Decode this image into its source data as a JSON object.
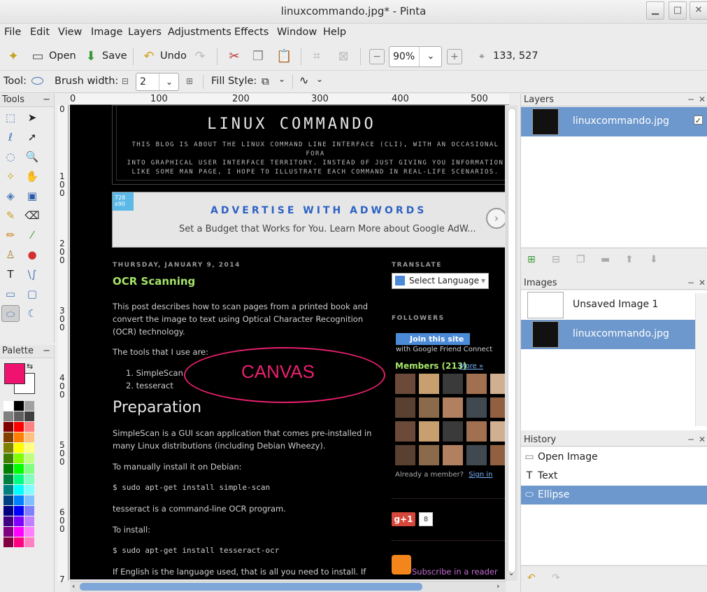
{
  "window": {
    "title": "linuxcommando.jpg* - Pinta",
    "minimize": "▁",
    "maximize": "□",
    "close": "✕"
  },
  "menu": [
    "File",
    "Edit",
    "View",
    "Image",
    "Layers",
    "Adjustments",
    "Effects",
    "Window",
    "Help"
  ],
  "toolbar": {
    "open": "Open",
    "save": "Save",
    "undo": "Undo",
    "zoom": "90%",
    "coords": "133, 527"
  },
  "tool_options": {
    "tool_label": "Tool:",
    "brush_width_label": "Brush width:",
    "brush_width": "2",
    "fill_style_label": "Fill Style:"
  },
  "panels": {
    "tools": "Tools",
    "palette": "Palette",
    "layers": "Layers",
    "images": "Images",
    "history": "History"
  },
  "ruler": {
    "h": [
      "0",
      "100",
      "200",
      "300",
      "400",
      "500"
    ],
    "v": [
      "0",
      "1\n0\n0",
      "2\n0\n0",
      "3\n0\n0",
      "4\n0\n0",
      "5\n0\n0",
      "6\n0\n0",
      "7"
    ]
  },
  "layers": [
    {
      "name": "linuxcommando.jpg",
      "visible": true
    }
  ],
  "images": [
    {
      "name": "Unsaved Image 1",
      "selected": false
    },
    {
      "name": "linuxcommando.jpg",
      "selected": true
    }
  ],
  "history": [
    {
      "label": "Open Image",
      "icon": "open-image-icon"
    },
    {
      "label": "Text",
      "icon": "text-tool-icon"
    },
    {
      "label": "Ellipse",
      "icon": "ellipse-tool-icon"
    }
  ],
  "colors": {
    "primary": "#f0126f",
    "secondary": "#ffffff",
    "selection": "#6d98cd"
  },
  "blog": {
    "title": "LINUX COMMANDO",
    "desc1": "THIS BLOG IS ABOUT THE LINUX COMMAND LINE INTERFACE (CLI), WITH AN OCCASIONAL FORA",
    "desc2": "INTO GRAPHICAL USER INTERFACE TERRITORY. INSTEAD OF JUST GIVING YOU INFORMATION",
    "desc3": "LIKE SOME MAN PAGE, I HOPE TO ILLUSTRATE EACH COMMAND IN REAL-LIFE SCENARIOS.",
    "ad_badge": "728 x90",
    "ad_title": "ADVERTISE WITH ADWORDS",
    "ad_sub": "Set a Budget that Works for You. Learn More about Google AdW...",
    "date": "THURSDAY, JANUARY 9, 2014",
    "post_title": "OCR Scanning",
    "intro": "This post describes how to scan pages from a printed book and convert the image to text using Optical Character Recognition (OCR) technology.",
    "tools_line": "The tools that I use are:",
    "list1": "1. SimpleScan",
    "list2": "2. tesseract",
    "h2": "Preparation",
    "para2": "SimpleScan is a GUI scan application that comes pre-installed in many Linux distributions (including Debian Wheezy).",
    "para3": "To manually install it on Debian:",
    "cmd1": "$ sudo apt-get install simple-scan",
    "para4": "tesseract is a command-line OCR program.",
    "para5": "To install:",
    "cmd2": "$ sudo apt-get install tesseract-ocr",
    "para6": "If English is the language used, that is all you need to install. If you",
    "translate": "TRANSLATE",
    "select_lang": "Select Language",
    "followers": "FOLLOWERS",
    "join": "Join this site",
    "gfc": "with Google Friend Connect",
    "members": "Members (213)",
    "more": "More »",
    "already": "Already a member?",
    "signin": "Sign in",
    "gplus": "g+1",
    "gcount": "8",
    "subscribe": "Subscribe in a reader",
    "canvas_text": "CANVAS"
  }
}
